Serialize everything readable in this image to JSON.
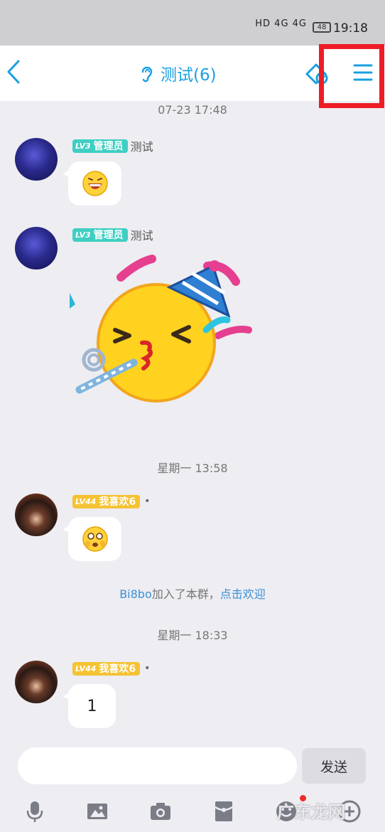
{
  "status_bar": {
    "signal_text": "HD 4G 4G",
    "battery": "48",
    "time": "19:18"
  },
  "header": {
    "title": "测试(6)"
  },
  "messages": [
    {
      "timestamp": "07-23 17:48",
      "level": "LV3",
      "role": "管理员",
      "sender": "测试",
      "content_type": "emoji",
      "emoji": "laughing-face"
    },
    {
      "level": "LV3",
      "role": "管理员",
      "sender": "测试",
      "content_type": "sticker",
      "emoji": "party-face"
    },
    {
      "timestamp": "星期一 13:58",
      "level": "LV44",
      "role": "我喜欢6",
      "sender": "•",
      "content_type": "emoji",
      "emoji": "face-in-hands"
    },
    {
      "system": true,
      "name": "Bi8bo",
      "text": "加入了本群，",
      "link": "点击欢迎"
    },
    {
      "timestamp": "星期一 18:33",
      "level": "LV44",
      "role": "我喜欢6",
      "sender": "•",
      "content_type": "text",
      "text": "1"
    }
  ],
  "input": {
    "placeholder": "",
    "send_label": "发送"
  },
  "toolbar": [
    "microphone-icon",
    "image-icon",
    "camera-icon",
    "red-packet-icon",
    "emoji-icon",
    "more-icon"
  ],
  "watermark": "广东龙网",
  "colors": {
    "accent": "#1aa0e0",
    "admin_badge": "#3fcfc2",
    "user_badge": "#f5c232",
    "highlight": "#ee1c25"
  }
}
